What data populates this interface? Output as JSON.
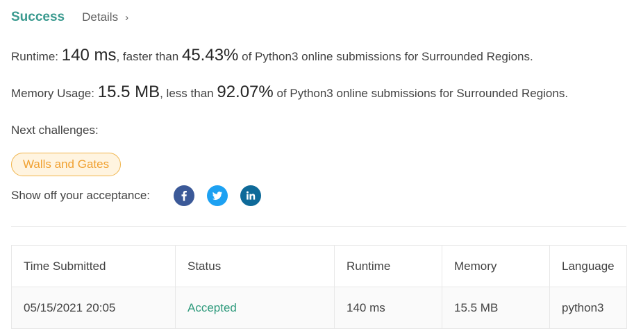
{
  "header": {
    "status_title": "Success",
    "details_link": "Details",
    "details_chevron": "›"
  },
  "runtime": {
    "label": "Runtime:",
    "value": "140 ms",
    "comparison": ", faster than",
    "percent": "45.43%",
    "suffix": "of Python3 online submissions for Surrounded Regions."
  },
  "memory": {
    "label": "Memory Usage:",
    "value": "15.5 MB",
    "comparison": ", less than",
    "percent": "92.07%",
    "suffix": "of Python3 online submissions for Surrounded Regions."
  },
  "next": {
    "label": "Next challenges:",
    "challenges": [
      "Walls and Gates"
    ]
  },
  "share": {
    "label": "Show off your acceptance:",
    "icons": [
      "facebook-icon",
      "twitter-icon",
      "linkedin-icon"
    ]
  },
  "colors": {
    "success": "#3a9a8f",
    "accepted": "#2e9a7c",
    "challenge_border": "#f0b44a",
    "challenge_text": "#f0a030",
    "facebook": "#3b5998",
    "twitter": "#1da1f2",
    "linkedin": "#0e6a99"
  },
  "table": {
    "columns": [
      "Time Submitted",
      "Status",
      "Runtime",
      "Memory",
      "Language"
    ],
    "rows": [
      {
        "time": "05/15/2021 20:05",
        "status": "Accepted",
        "runtime": "140 ms",
        "memory": "15.5 MB",
        "language": "python3"
      }
    ]
  }
}
